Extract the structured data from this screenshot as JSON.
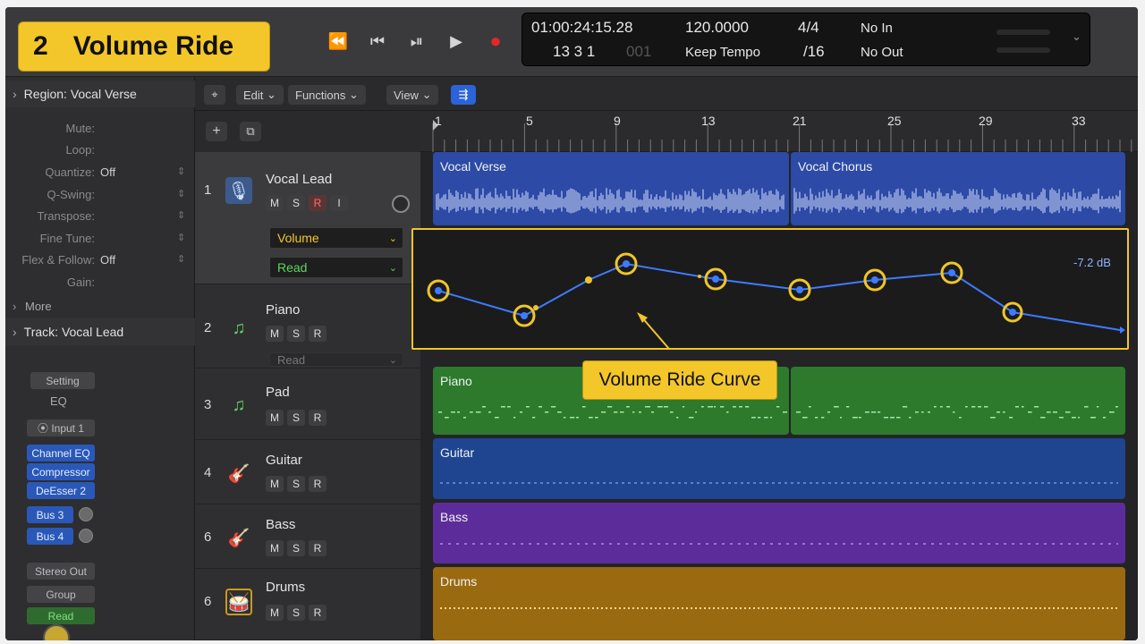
{
  "title_badge": {
    "number": "2",
    "text": "Volume Ride"
  },
  "transport": {
    "rewind": "⏪",
    "to_start": "⏮",
    "cycle": "⏯",
    "play": "▶",
    "record": "●"
  },
  "lcd": {
    "time": "01:00:24:15.28",
    "bars": "13  3  1",
    "ticks": "001",
    "tempo": "120.0000",
    "tempo_mode": "Keep Tempo",
    "sig_top": "4/4",
    "sig_bottom": "/16",
    "in": "No In",
    "out": "No Out"
  },
  "inspector": {
    "region_header": "Region:",
    "region_name": "Vocal Verse",
    "params": [
      {
        "label": "Mute:",
        "value": ""
      },
      {
        "label": "Loop:",
        "value": ""
      },
      {
        "label": "Quantize:",
        "value": "Off"
      },
      {
        "label": "Q-Swing:",
        "value": ""
      },
      {
        "label": "Transpose:",
        "value": ""
      },
      {
        "label": "Fine Tune:",
        "value": ""
      },
      {
        "label": "Flex & Follow:",
        "value": "Off"
      },
      {
        "label": "Gain:",
        "value": ""
      }
    ],
    "more": "More",
    "track_header": "Track:",
    "track_name": "Vocal Lead",
    "setting": "Setting",
    "eq": "EQ",
    "input": "Input 1",
    "plugins": [
      "Channel EQ",
      "Compressor",
      "DeEsser 2"
    ],
    "sends": [
      "Bus 3",
      "Bus 4"
    ],
    "output": "Stereo Out",
    "group": "Group",
    "automation": "Read"
  },
  "local_bar": {
    "edit": "Edit",
    "functions": "Functions",
    "view": "View"
  },
  "tracks": [
    {
      "num": "1",
      "name": "Vocal Lead",
      "icon": "mic-icon",
      "automation_param": "Volume",
      "automation_mode": "Read"
    },
    {
      "num": "2",
      "name": "Piano",
      "icon": "note-icon",
      "automation_mode": "Read"
    },
    {
      "num": "3",
      "name": "Pad",
      "icon": "note-icon"
    },
    {
      "num": "4",
      "name": "Guitar",
      "icon": "guitar-icon"
    },
    {
      "num": "6",
      "name": "Bass",
      "icon": "bass-icon"
    },
    {
      "num": "6",
      "name": "Drums",
      "icon": "drums-icon"
    }
  ],
  "msr": {
    "m": "M",
    "s": "S",
    "r": "R",
    "i": "I"
  },
  "ruler": [
    "1",
    "5",
    "9",
    "13",
    "21",
    "25",
    "29",
    "33"
  ],
  "regions": {
    "vocal_verse": "Vocal Verse",
    "vocal_chorus": "Vocal Chorus",
    "piano": "Piano",
    "guitar": "Guitar",
    "bass": "Bass",
    "drums": "Drums"
  },
  "automation": {
    "db_label": "-7.2 dB",
    "callout": "Volume Ride Curve",
    "line_color": "#3e7bff",
    "highlight_color": "#f0c52a"
  },
  "colors": {
    "vocal": "#2c4aa6",
    "piano": "#2d7a2d",
    "guitar": "#1f4591",
    "bass": "#5c2d9a",
    "drums": "#9a6a10"
  }
}
